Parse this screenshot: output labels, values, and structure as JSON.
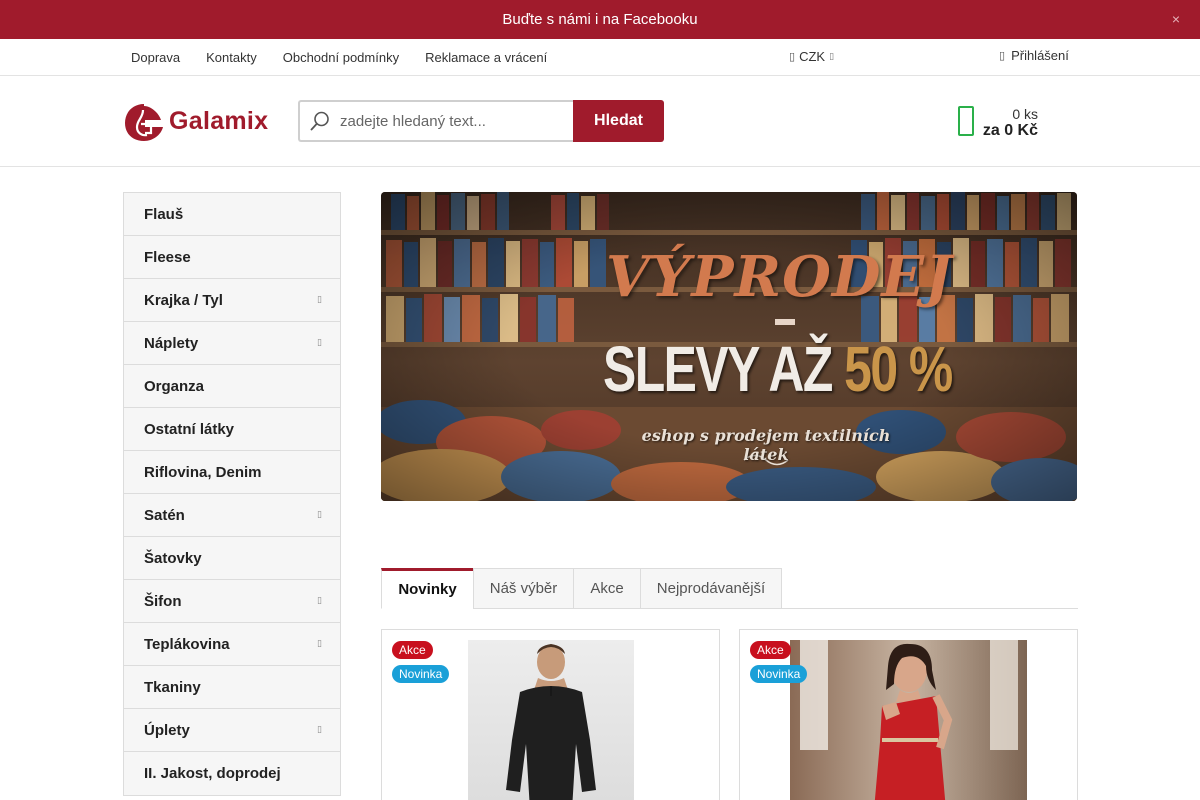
{
  "promo": {
    "text": "Buďte s námi i na Facebooku",
    "close": "×"
  },
  "toplinks": [
    "Doprava",
    "Kontakty",
    "Obchodní podmínky",
    "Reklamace a vrácení"
  ],
  "currency": {
    "label": "CZK"
  },
  "login": {
    "label": "Přihlášení"
  },
  "logo": {
    "text": "Galamix"
  },
  "search": {
    "placeholder": "zadejte hledaný text...",
    "button": "Hledat"
  },
  "cart": {
    "qty": "0 ks",
    "price": "za 0 Kč"
  },
  "sidebar": {
    "items": [
      {
        "label": "Flauš",
        "has_children": false
      },
      {
        "label": "Fleese",
        "has_children": false
      },
      {
        "label": "Krajka / Tyl",
        "has_children": true
      },
      {
        "label": "Náplety",
        "has_children": true
      },
      {
        "label": "Organza",
        "has_children": false
      },
      {
        "label": "Ostatní látky",
        "has_children": false
      },
      {
        "label": "Riflovina, Denim",
        "has_children": false
      },
      {
        "label": "Satén",
        "has_children": true
      },
      {
        "label": "Šatovky",
        "has_children": false
      },
      {
        "label": "Šifon",
        "has_children": true
      },
      {
        "label": "Teplákovina",
        "has_children": true
      },
      {
        "label": "Tkaniny",
        "has_children": false
      },
      {
        "label": "Úplety",
        "has_children": true
      },
      {
        "label": "II. Jakost, doprodej",
        "has_children": false
      }
    ]
  },
  "banner": {
    "title": "VÝPRODEJ",
    "slevy": "SLEVY AŽ",
    "percent": "50 %",
    "subtitle": "eshop s prodejem textilních látek"
  },
  "tabs": [
    {
      "label": "Novinky",
      "active": true
    },
    {
      "label": "Náš výběr",
      "active": false
    },
    {
      "label": "Akce",
      "active": false
    },
    {
      "label": "Nejprodávanější",
      "active": false
    }
  ],
  "products": [
    {
      "badges": [
        "Akce",
        "Novinka"
      ],
      "image": "man-black-thermal-underwear"
    },
    {
      "badges": [
        "Akce",
        "Novinka"
      ],
      "image": "woman-red-one-shoulder-dress"
    }
  ],
  "colors": {
    "brand": "#a01b2c",
    "cart": "#2ab04a",
    "badge_akce": "#c8101e",
    "badge_novinka": "#1aa0d8"
  }
}
